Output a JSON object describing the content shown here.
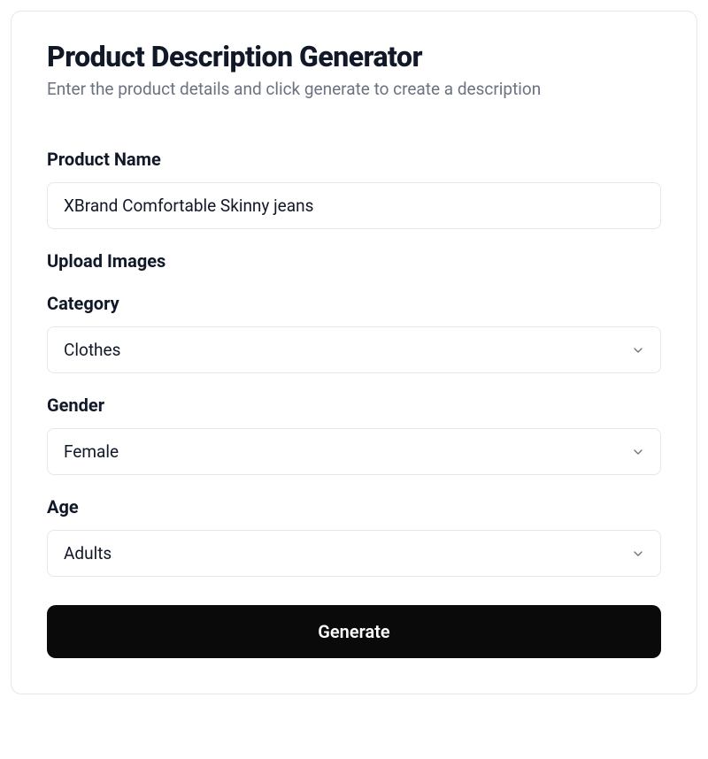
{
  "header": {
    "title": "Product Description Generator",
    "subtitle": "Enter the product details and click generate to create a description"
  },
  "form": {
    "productName": {
      "label": "Product Name",
      "value": "XBrand Comfortable Skinny jeans"
    },
    "uploadImages": {
      "label": "Upload Images"
    },
    "category": {
      "label": "Category",
      "value": "Clothes"
    },
    "gender": {
      "label": "Gender",
      "value": "Female"
    },
    "age": {
      "label": "Age",
      "value": "Adults"
    },
    "submit": {
      "label": "Generate"
    }
  }
}
